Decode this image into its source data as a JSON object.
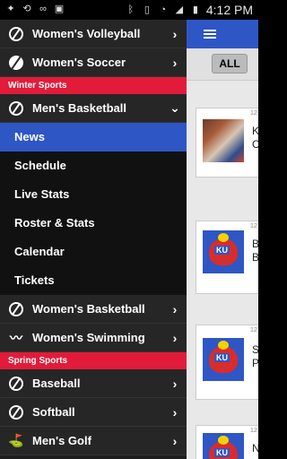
{
  "status_bar": {
    "time": "4:12 PM"
  },
  "drawer": {
    "sports_top": [
      {
        "label": "Women's Volleyball",
        "icon": "volleyball-icon"
      },
      {
        "label": "Women's Soccer",
        "icon": "soccer-ball-icon"
      }
    ],
    "winter_header": "Winter Sports",
    "mens_basketball": {
      "label": "Men's Basketball",
      "icon": "basketball-icon"
    },
    "sub_items": [
      "News",
      "Schedule",
      "Live Stats",
      "Roster & Stats",
      "Calendar",
      "Tickets"
    ],
    "winter_more": [
      {
        "label": "Women's Basketball",
        "icon": "basketball-icon"
      },
      {
        "label": "Women's Swimming",
        "icon": "waves-icon"
      }
    ],
    "spring_header": "Spring Sports",
    "spring": [
      {
        "label": "Baseball",
        "icon": "baseball-icon"
      },
      {
        "label": "Softball",
        "icon": "softball-icon"
      },
      {
        "label": "Men's Golf",
        "icon": "golf-icon"
      }
    ]
  },
  "content": {
    "filter_label": "ALL",
    "cards": [
      {
        "date": "12",
        "title": "K\nC"
      },
      {
        "date": "12",
        "title": "B\nB"
      },
      {
        "date": "12",
        "title": "S\nP"
      },
      {
        "date": "12",
        "title": "N"
      }
    ]
  },
  "colors": {
    "accent_blue": "#2e56c5",
    "section_red": "#e21b3a",
    "drawer_bg": "#1e1e1e"
  }
}
